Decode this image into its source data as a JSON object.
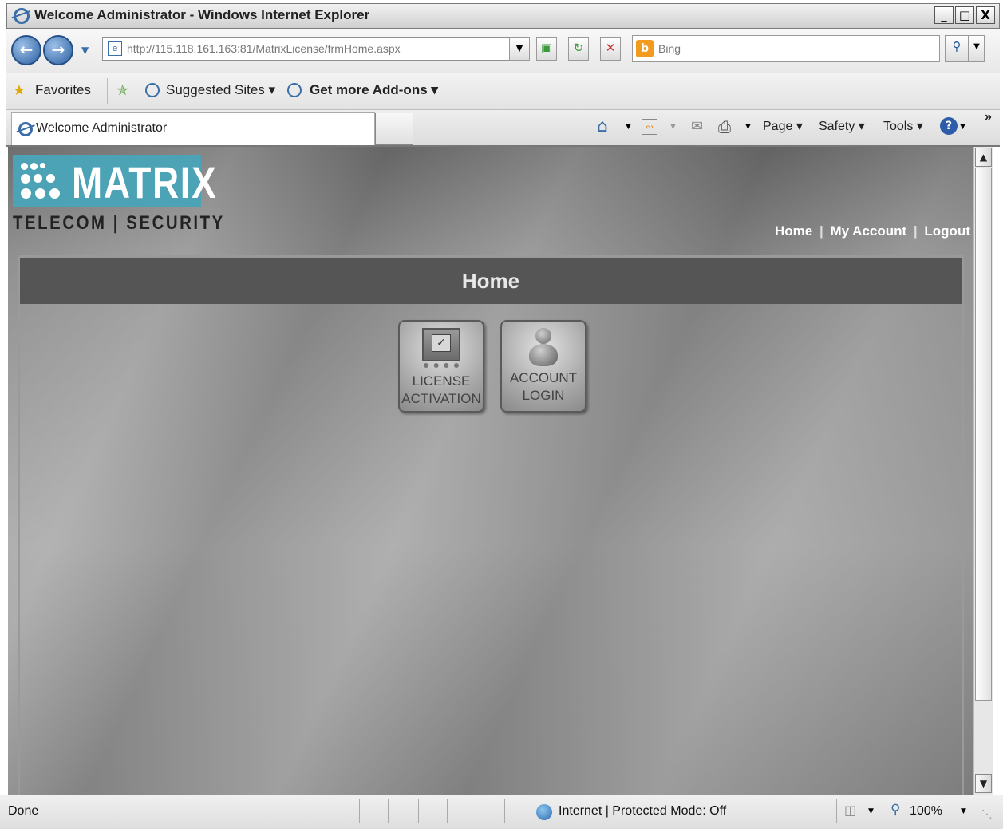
{
  "window": {
    "title": "Welcome Administrator - Windows Internet Explorer",
    "controls": {
      "minimize": "_",
      "maximize": "□",
      "close": "X"
    }
  },
  "navbar": {
    "url": "http://115.118.161.163:81/MatrixLicense/frmHome.aspx",
    "search_placeholder": "Bing"
  },
  "favorites_bar": {
    "favorites_label": "Favorites",
    "suggested_sites": "Suggested Sites ▾",
    "get_addons": "Get more Add-ons ▾"
  },
  "tab": {
    "label": "Welcome Administrator"
  },
  "command_bar": {
    "page": "Page ▾",
    "safety": "Safety ▾",
    "tools": "Tools ▾",
    "overflow": "»"
  },
  "site": {
    "brand": "MATRIX",
    "tagline": "TELECOM | SECURITY",
    "links": {
      "home": "Home",
      "sep1": "|",
      "my_account": "My Account",
      "sep2": "|",
      "logout": "Logout"
    },
    "panel_title": "Home",
    "tiles": [
      {
        "line1": "LICENSE",
        "line2": "ACTIVATION"
      },
      {
        "line1": "ACCOUNT",
        "line2": "LOGIN"
      }
    ]
  },
  "statusbar": {
    "status": "Done",
    "zone": "Internet | Protected Mode: Off",
    "zoom": "100%"
  }
}
